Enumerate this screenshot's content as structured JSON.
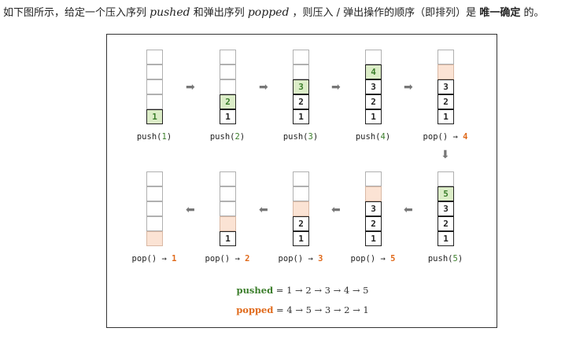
{
  "intro": {
    "p1": "如下图所示，给定一个压入序列 ",
    "pushed": "pushed",
    "p2": " 和弹出序列 ",
    "popped": "popped",
    "p3": " ，则压入 / 弹出操作的顺序（即排列）是 ",
    "emph": "唯一确定",
    "p4": " 的。"
  },
  "steps": [
    {
      "op": "push",
      "arg": "1",
      "result": "",
      "cells": [
        {
          "v": "",
          "s": ""
        },
        {
          "v": "",
          "s": ""
        },
        {
          "v": "",
          "s": ""
        },
        {
          "v": "",
          "s": ""
        },
        {
          "v": "1",
          "s": "hl"
        }
      ]
    },
    {
      "op": "push",
      "arg": "2",
      "result": "",
      "cells": [
        {
          "v": "",
          "s": ""
        },
        {
          "v": "",
          "s": ""
        },
        {
          "v": "",
          "s": ""
        },
        {
          "v": "2",
          "s": "hl"
        },
        {
          "v": "1",
          "s": "solid"
        }
      ]
    },
    {
      "op": "push",
      "arg": "3",
      "result": "",
      "cells": [
        {
          "v": "",
          "s": ""
        },
        {
          "v": "",
          "s": ""
        },
        {
          "v": "3",
          "s": "hl"
        },
        {
          "v": "2",
          "s": "solid"
        },
        {
          "v": "1",
          "s": "solid"
        }
      ]
    },
    {
      "op": "push",
      "arg": "4",
      "result": "",
      "cells": [
        {
          "v": "",
          "s": ""
        },
        {
          "v": "4",
          "s": "hl"
        },
        {
          "v": "3",
          "s": "solid"
        },
        {
          "v": "2",
          "s": "solid"
        },
        {
          "v": "1",
          "s": "solid"
        }
      ]
    },
    {
      "op": "pop",
      "arg": "",
      "result": "4",
      "cells": [
        {
          "v": "",
          "s": ""
        },
        {
          "v": "",
          "s": "popped"
        },
        {
          "v": "3",
          "s": "solid"
        },
        {
          "v": "2",
          "s": "solid"
        },
        {
          "v": "1",
          "s": "solid"
        }
      ]
    },
    {
      "op": "push",
      "arg": "5",
      "result": "",
      "cells": [
        {
          "v": "",
          "s": ""
        },
        {
          "v": "5",
          "s": "hl"
        },
        {
          "v": "3",
          "s": "solid"
        },
        {
          "v": "2",
          "s": "solid"
        },
        {
          "v": "1",
          "s": "solid"
        }
      ]
    },
    {
      "op": "pop",
      "arg": "",
      "result": "5",
      "cells": [
        {
          "v": "",
          "s": ""
        },
        {
          "v": "",
          "s": "popped"
        },
        {
          "v": "3",
          "s": "solid"
        },
        {
          "v": "2",
          "s": "solid"
        },
        {
          "v": "1",
          "s": "solid"
        }
      ]
    },
    {
      "op": "pop",
      "arg": "",
      "result": "3",
      "cells": [
        {
          "v": "",
          "s": ""
        },
        {
          "v": "",
          "s": ""
        },
        {
          "v": "",
          "s": "popped"
        },
        {
          "v": "2",
          "s": "solid"
        },
        {
          "v": "1",
          "s": "solid"
        }
      ]
    },
    {
      "op": "pop",
      "arg": "",
      "result": "2",
      "cells": [
        {
          "v": "",
          "s": ""
        },
        {
          "v": "",
          "s": ""
        },
        {
          "v": "",
          "s": ""
        },
        {
          "v": "",
          "s": "popped"
        },
        {
          "v": "1",
          "s": "solid"
        }
      ]
    },
    {
      "op": "pop",
      "arg": "",
      "result": "1",
      "cells": [
        {
          "v": "",
          "s": ""
        },
        {
          "v": "",
          "s": ""
        },
        {
          "v": "",
          "s": ""
        },
        {
          "v": "",
          "s": ""
        },
        {
          "v": "",
          "s": "popped"
        }
      ]
    }
  ],
  "sequences": {
    "pushed_label": "pushed",
    "pushed_value": " = 1 → 2 → 3 → 4 → 5",
    "popped_label": "popped",
    "popped_value": " = 4 → 5 → 3 → 2 → 1"
  },
  "colors": {
    "push_highlight": "#dcedc8",
    "popped_cell": "#fbe3d4",
    "result": "#e06a1b",
    "green": "#3a7d2a"
  }
}
